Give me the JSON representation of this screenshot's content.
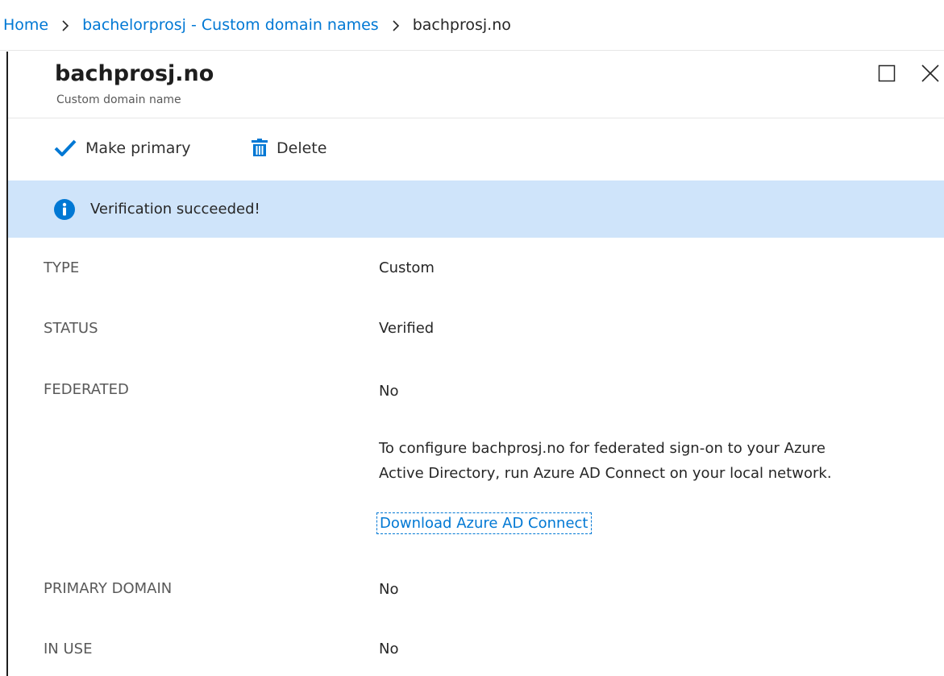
{
  "breadcrumb": {
    "home": "Home",
    "parent": "bachelorprosj - Custom domain names",
    "current": "bachprosj.no"
  },
  "blade": {
    "title": "bachprosj.no",
    "subtitle": "Custom domain name",
    "maximize_icon": "maximize-icon",
    "close_icon": "close-icon"
  },
  "toolbar": {
    "make_primary_label": "Make primary",
    "delete_label": "Delete"
  },
  "banner": {
    "text": "Verification succeeded!",
    "icon": "info-icon",
    "color": "#cfe4fa"
  },
  "properties": {
    "type": {
      "label": "TYPE",
      "value": "Custom"
    },
    "status": {
      "label": "STATUS",
      "value": "Verified"
    },
    "federated": {
      "label": "FEDERATED",
      "value": "No",
      "note_line1": "To configure bachprosj.no for federated sign-on to your Azure",
      "note_line2": "Active Directory, run Azure AD Connect on your local network.",
      "link": "Download Azure AD Connect"
    },
    "primary_domain": {
      "label": "PRIMARY DOMAIN",
      "value": "No"
    },
    "in_use": {
      "label": "IN USE",
      "value": "No"
    }
  },
  "colors": {
    "accent": "#0078d4",
    "banner": "#cfe4fa"
  }
}
